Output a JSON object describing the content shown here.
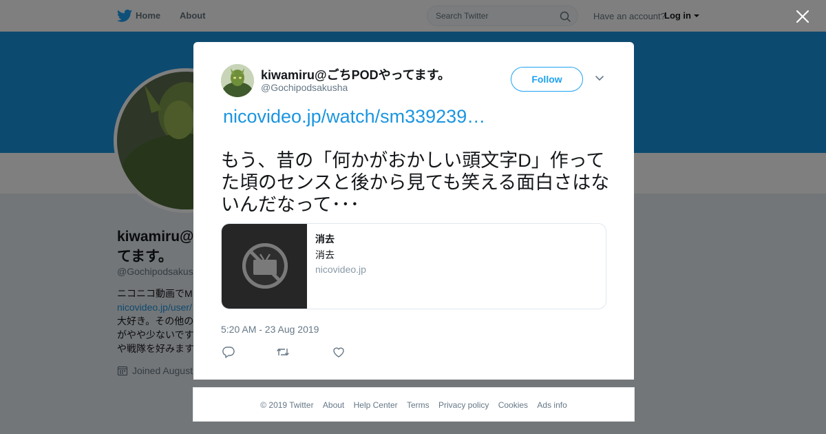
{
  "nav": {
    "home_label": "Home",
    "about_label": "About",
    "search_placeholder": "Search Twitter",
    "account_prompt": "Have an account?",
    "login_label": "Log in"
  },
  "profile": {
    "name_line1": "kiwamiru@",
    "name_line2": "てます。",
    "handle": "@Gochipodsakus",
    "bio_lines": [
      "ニコニコ動画でM",
      "nicovideo.jp/user/",
      "大好き。その他の",
      "がやや少ないです",
      "や戦隊を好みます"
    ],
    "joined": "Joined August"
  },
  "tweet": {
    "author_name": "kiwamiru@ごちPODやってます。",
    "author_handle": "@Gochipodsakusha",
    "follow_label": "Follow",
    "link_text": "nicovideo.jp/watch/sm339239…",
    "text": "もう、昔の「何かがおかしい頭文字D」作ってた頃のセンスと後から見ても笑える面白さはないんだなって･･･",
    "card": {
      "title": "消去",
      "description": "消去",
      "domain": "nicovideo.jp"
    },
    "timestamp": "5:20 AM - 23 Aug 2019"
  },
  "footer": {
    "copyright": "© 2019 Twitter",
    "links": [
      "About",
      "Help Center",
      "Terms",
      "Privacy policy",
      "Cookies",
      "Ads info"
    ]
  },
  "colors": {
    "brand_blue": "#1da1f2",
    "link_blue": "#1b95e0",
    "banner_blue": "#1b95e0"
  }
}
